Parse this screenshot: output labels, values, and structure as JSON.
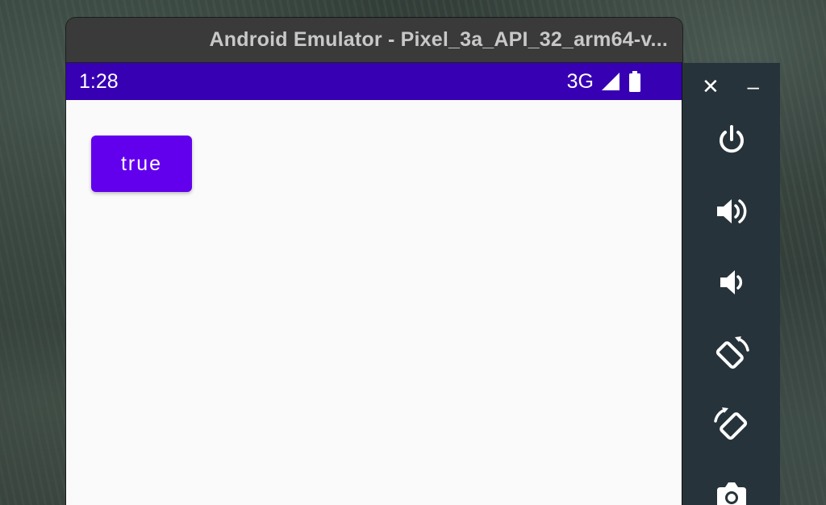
{
  "window": {
    "title": "Android Emulator - Pixel_3a_API_32_arm64-v..."
  },
  "status_bar": {
    "time": "1:28",
    "network": "3G",
    "background": "#3700b3"
  },
  "app": {
    "button_label": "true",
    "button_color": "#6200ee"
  },
  "side_panel": {
    "close": "✕",
    "minimize": "–",
    "buttons": [
      {
        "icon": "power-icon"
      },
      {
        "icon": "volume-up-icon"
      },
      {
        "icon": "volume-down-icon"
      },
      {
        "icon": "rotate-left-icon"
      },
      {
        "icon": "rotate-right-icon"
      },
      {
        "icon": "camera-icon"
      }
    ]
  }
}
